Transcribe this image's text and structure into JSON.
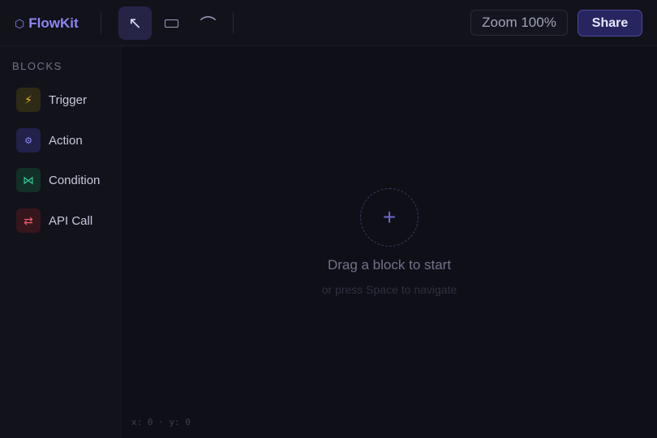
{
  "header": {
    "logo_icon": "⬡",
    "app_name": "FlowKit",
    "zoom_label": "Zoom 100%",
    "share_label": "Share",
    "tools": [
      {
        "name": "select",
        "icon": "↖",
        "active": true
      },
      {
        "name": "rectangle",
        "icon": "rectangle-icon",
        "active": false
      },
      {
        "name": "connector",
        "icon": "⌒",
        "active": false
      }
    ]
  },
  "sidebar": {
    "title": "BLOCKS",
    "items": [
      {
        "label": "Trigger",
        "icon": "⚡",
        "color": "#f2b705"
      },
      {
        "label": "Action",
        "icon": "⚙",
        "color": "#8d89f5"
      },
      {
        "label": "Condition",
        "icon": "⋈",
        "color": "#2ecc93"
      },
      {
        "label": "API Call",
        "icon": "⇄",
        "color": "#ef5d70"
      }
    ]
  },
  "canvas": {
    "add_icon": "+",
    "empty_title": "Drag a block to start",
    "empty_subtitle": "or press Space to navigate",
    "coords": "x: 0 · y: 0"
  },
  "colors": {
    "accent": "#8b87f2",
    "background": "#0f0f17"
  }
}
